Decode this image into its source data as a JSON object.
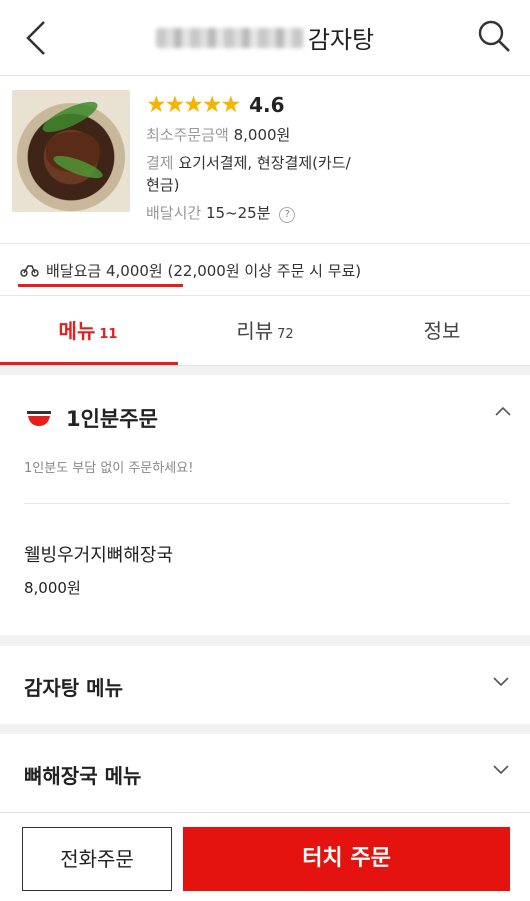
{
  "header": {
    "title_visible": "감자탕",
    "back_icon": "chevron-left-icon",
    "search_icon": "search-icon"
  },
  "restaurant": {
    "stars": "★★★★★",
    "rating": "4.6",
    "min_order_label": "최소주문금액",
    "min_order_value": "8,000원",
    "payment_label": "결제",
    "payment_value_line1": "요기서결제, 현장결제(카드/",
    "payment_value_line2": "현금)",
    "delivery_time_label": "배달시간",
    "delivery_time_value": "15~25분",
    "help_mark": "?"
  },
  "delivery_fee": {
    "text": "배달요금 4,000원",
    "note": "(22,000원 이상 주문 시 무료)"
  },
  "tabs": [
    {
      "label": "메뉴",
      "count": "11"
    },
    {
      "label": "리뷰",
      "count": "72"
    },
    {
      "label": "정보",
      "count": ""
    }
  ],
  "sections": {
    "single": {
      "title": "1인분주문",
      "description": "1인분도 부담 없이 주문하세요!",
      "items": [
        {
          "name": "웰빙우거지뼈해장국",
          "price": "8,000원"
        }
      ]
    },
    "categories": [
      {
        "name": "감자탕 메뉴"
      },
      {
        "name": "뼈해장국 메뉴"
      }
    ]
  },
  "footer": {
    "phone_order": "전화주문",
    "touch_order": "터치 주문"
  },
  "colors": {
    "accent": "#e51e1e",
    "star": "#f6b300",
    "order_button": "#e5130f"
  }
}
